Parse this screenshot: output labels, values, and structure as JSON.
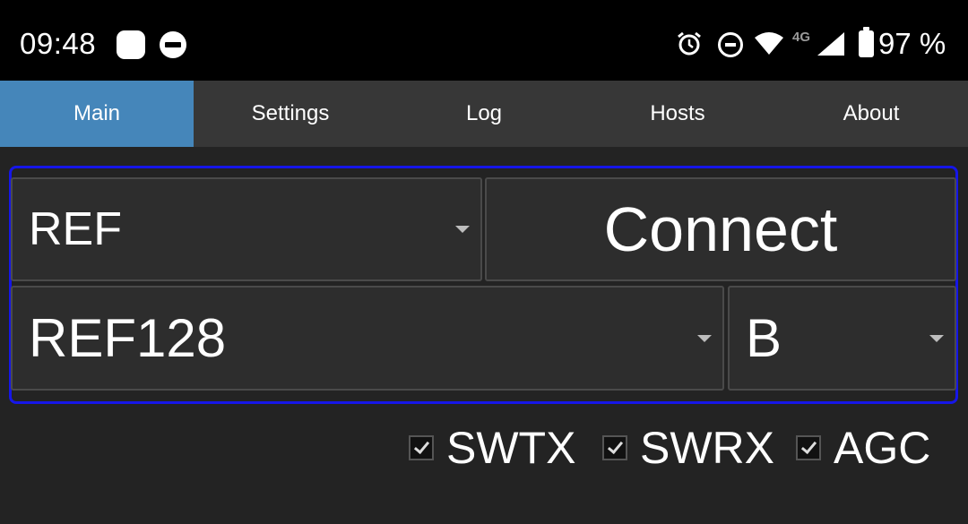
{
  "status_bar": {
    "time": "09:48",
    "network_type": "4G",
    "battery_percent": "97 %",
    "icons": [
      "app-icon",
      "dnd-icon",
      "alarm-icon",
      "dnd-icon",
      "wifi-icon",
      "signal-icon",
      "battery-icon"
    ]
  },
  "tabs": [
    {
      "label": "Main",
      "active": true
    },
    {
      "label": "Settings",
      "active": false
    },
    {
      "label": "Hosts",
      "active": false
    },
    {
      "label": "Log",
      "active": false
    },
    {
      "label": "About",
      "active": false
    }
  ],
  "tab_order": [
    "Main",
    "Settings",
    "Log",
    "Hosts",
    "About"
  ],
  "main": {
    "mode_select": {
      "value": "REF"
    },
    "connect_button": {
      "label": "Connect"
    },
    "reflector_select": {
      "value": "REF128"
    },
    "module_select": {
      "value": "B"
    }
  },
  "options": {
    "swtx": {
      "label": "SWTX",
      "checked": true
    },
    "swrx": {
      "label": "SWRX",
      "checked": true
    },
    "agc": {
      "label": "AGC",
      "checked": true
    }
  },
  "colors": {
    "active_tab": "#4586ba",
    "panel_border": "#1616e8",
    "background": "#232323"
  }
}
